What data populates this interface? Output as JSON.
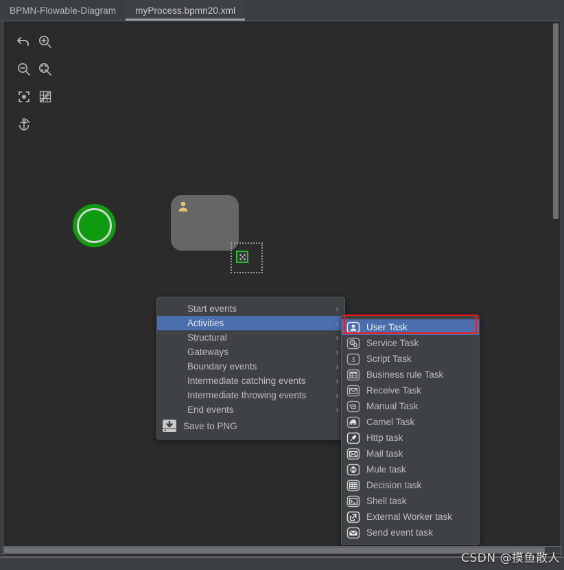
{
  "window": {
    "title": "BPMN-Flowable-Diagram"
  },
  "tabs": [
    {
      "label": "BPMN-Flowable-Diagram",
      "active": false
    },
    {
      "label": "myProcess.bpmn20.xml",
      "active": true
    }
  ],
  "toolbar": {
    "items": [
      {
        "name": "undo-icon",
        "tooltip": "Undo"
      },
      {
        "name": "zoom-in-icon",
        "tooltip": "Zoom In"
      },
      {
        "name": "zoom-out-icon",
        "tooltip": "Zoom Out"
      },
      {
        "name": "actual-size-icon",
        "tooltip": "Actual Size"
      },
      {
        "name": "fit-content-icon",
        "tooltip": "Fit Content"
      },
      {
        "name": "toggle-grid-icon",
        "tooltip": "Toggle Grid"
      },
      {
        "name": "toggle-snap-icon",
        "tooltip": "Toggle Snap to Grid"
      }
    ]
  },
  "canvas": {
    "shapes": [
      {
        "type": "start-event",
        "name": "start-event-node",
        "fill": "#0f9b0f",
        "ring": "#d4d4d4"
      },
      {
        "type": "user-task",
        "name": "user-task-node",
        "fill": "#666666",
        "icon": "user-icon",
        "icon_color": "#e3c373"
      },
      {
        "type": "drop-placeholder",
        "name": "drop-placeholder",
        "accent": "#24c424"
      }
    ]
  },
  "context_menu": {
    "name": "diagram-context-menu",
    "items": [
      {
        "label": "Start events",
        "submenu": true,
        "selected": false
      },
      {
        "label": "Activities",
        "submenu": true,
        "selected": true
      },
      {
        "label": "Structural",
        "submenu": true,
        "selected": false
      },
      {
        "label": "Gateways",
        "submenu": true,
        "selected": false
      },
      {
        "label": "Boundary events",
        "submenu": true,
        "selected": false
      },
      {
        "label": "Intermediate catching events",
        "submenu": true,
        "selected": false
      },
      {
        "label": "Intermediate throwing events",
        "submenu": true,
        "selected": false
      },
      {
        "label": "End events",
        "submenu": true,
        "selected": false
      }
    ],
    "action": {
      "label": "Save to PNG",
      "icon": "save-to-png-icon"
    },
    "arrow_glyph": "›",
    "selection_color": "#4b6eaf"
  },
  "submenu": {
    "name": "activities-submenu",
    "items": [
      {
        "label": "User Task",
        "icon": "user-task-icon",
        "selected": true
      },
      {
        "label": "Service Task",
        "icon": "service-task-icon",
        "selected": false
      },
      {
        "label": "Script Task",
        "icon": "script-task-icon",
        "selected": false
      },
      {
        "label": "Business rule Task",
        "icon": "business-rule-task-icon",
        "selected": false
      },
      {
        "label": "Receive Task",
        "icon": "receive-task-icon",
        "selected": false
      },
      {
        "label": "Manual Task",
        "icon": "manual-task-icon",
        "selected": false
      },
      {
        "label": "Camel Task",
        "icon": "camel-task-icon",
        "selected": false
      },
      {
        "label": "Http task",
        "icon": "http-task-icon",
        "selected": false
      },
      {
        "label": "Mail task",
        "icon": "mail-task-icon",
        "selected": false
      },
      {
        "label": "Mule task",
        "icon": "mule-task-icon",
        "selected": false
      },
      {
        "label": "Decision task",
        "icon": "decision-task-icon",
        "selected": false
      },
      {
        "label": "Shell task",
        "icon": "shell-task-icon",
        "selected": false
      },
      {
        "label": "External Worker task",
        "icon": "external-worker-task-icon",
        "selected": false
      },
      {
        "label": "Send event task",
        "icon": "send-event-task-icon",
        "selected": false
      }
    ]
  },
  "annotation": {
    "name": "highlight-box",
    "color": "#f01c1c",
    "target": "User Task"
  },
  "watermark": {
    "text": "CSDN @摸鱼散人"
  },
  "scrollbars": {
    "vertical": {
      "thumb_color": "#6b6f71"
    },
    "horizontal": {
      "thumb_color": "#6f7376"
    }
  }
}
